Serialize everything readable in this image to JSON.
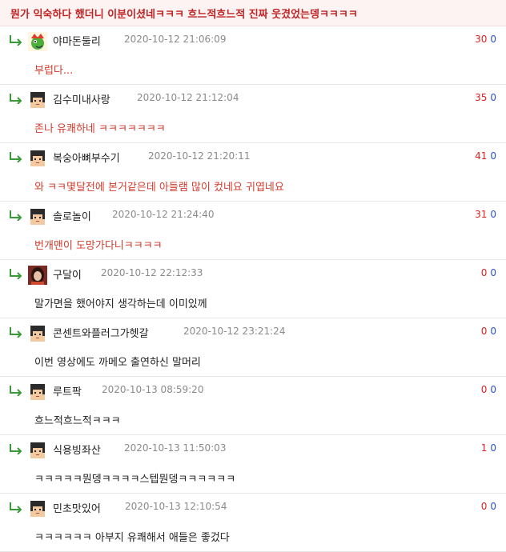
{
  "header": {
    "title": "뭔가 익숙하다 했더니 이분이셨네ㅋㅋㅋ 흐느적흐느적 진짜 웃겼었는뎅ㅋㅋㅋㅋ"
  },
  "colors": {
    "accent_red": "#d33a2c",
    "downvote_blue": "#2a4fd0",
    "reply_green": "#3a9a3a"
  },
  "comments": [
    {
      "avatar": "dino-avatar-icon",
      "nick": "야마돈둘리",
      "date": "2020-10-12 21:06:09",
      "up": "30",
      "down": "0",
      "body": "부럽다...",
      "tone": "red"
    },
    {
      "avatar": "pixel-face-avatar-icon",
      "nick": "김수미내사랑",
      "date": "2020-10-12 21:12:04",
      "up": "35",
      "down": "0",
      "body": "존나 유쾌하네 ㅋㅋㅋㅋㅋㅋㅋ",
      "tone": "red"
    },
    {
      "avatar": "pixel-face-avatar-icon",
      "nick": "복숭아뼈부수기",
      "date": "2020-10-12 21:20:11",
      "up": "41",
      "down": "0",
      "body": "와 ㅋㅋ몇달전에 본거같은데 아들램 많이 컸네요 귀엽네요",
      "tone": "red"
    },
    {
      "avatar": "pixel-face-avatar-icon",
      "nick": "솔로놀이",
      "date": "2020-10-12 21:24:40",
      "up": "31",
      "down": "0",
      "body": "번개맨이 도망가다니ㅋㅋㅋㅋ",
      "tone": "red"
    },
    {
      "avatar": "photo-avatar-icon",
      "nick": "구달이",
      "date": "2020-10-12 22:12:33",
      "up": "0",
      "down": "0",
      "body": "말가면을 했어야지 생각하는데 이미있께",
      "tone": "dark"
    },
    {
      "avatar": "pixel-face-avatar-icon",
      "nick": "콘센트와플러그가헷갈",
      "date": "2020-10-12 23:21:24",
      "up": "0",
      "down": "0",
      "body": "이번 영상에도 까메오 출연하신 말머리",
      "tone": "dark"
    },
    {
      "avatar": "pixel-face-avatar-icon",
      "nick": "루트팍",
      "date": "2020-10-13 08:59:20",
      "up": "0",
      "down": "0",
      "body": "흐느적흐느적ㅋㅋㅋ",
      "tone": "dark"
    },
    {
      "avatar": "pixel-face-avatar-icon",
      "nick": "식용빙좌산",
      "date": "2020-10-13 11:50:03",
      "up": "1",
      "down": "0",
      "body": "ㅋㅋㅋㅋㅋ뭔뎅ㅋㅋㅋㅋ스텝뭔뎅ㅋㅋㅋㅋㅋㅋ",
      "tone": "dark"
    },
    {
      "avatar": "pixel-face-avatar-icon",
      "nick": "민초맛있어",
      "date": "2020-10-13 12:10:54",
      "up": "0",
      "down": "0",
      "body": "ㅋㅋㅋㅋㅋㅋ 아부지 유쾌해서 애들은 좋겄다",
      "tone": "dark"
    }
  ]
}
